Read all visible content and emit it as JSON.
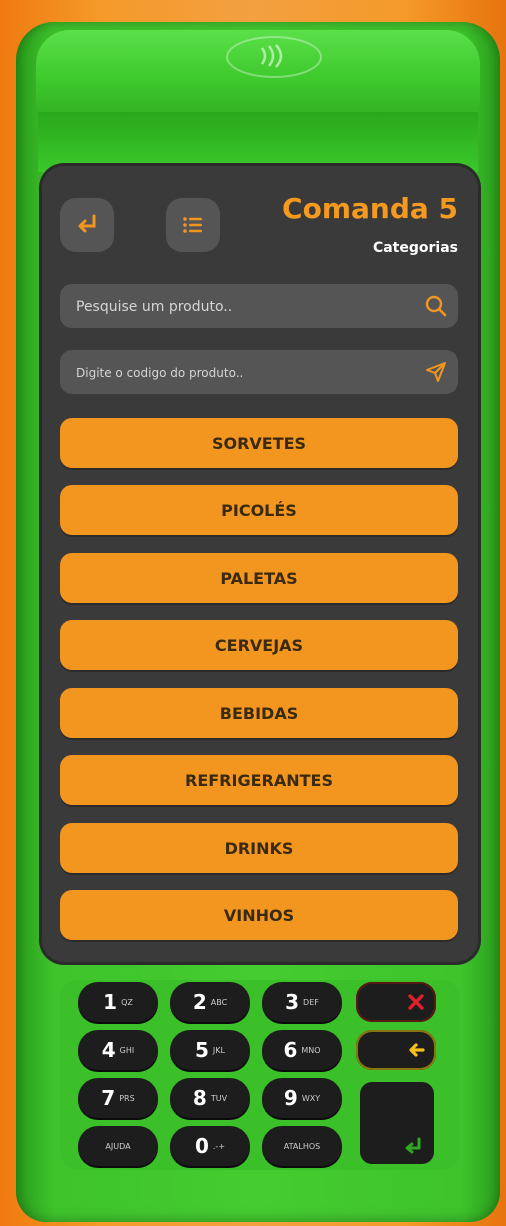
{
  "header": {
    "title": "Comanda 5",
    "subtitle": "Categorias"
  },
  "search": {
    "placeholder": "Pesquise um produto.."
  },
  "code": {
    "placeholder": "Digite o codigo do produto.."
  },
  "categories": [
    "SORVETES",
    "PICOLÉS",
    "PALETAS",
    "CERVEJAS",
    "BEBIDAS",
    "REFRIGERANTES",
    "DRINKS",
    "VINHOS"
  ],
  "keypad": {
    "k1": {
      "num": "1",
      "sub": "QZ"
    },
    "k2": {
      "num": "2",
      "sub": "ABC"
    },
    "k3": {
      "num": "3",
      "sub": "DEF"
    },
    "k4": {
      "num": "4",
      "sub": "GHI"
    },
    "k5": {
      "num": "5",
      "sub": "JKL"
    },
    "k6": {
      "num": "6",
      "sub": "MNO"
    },
    "k7": {
      "num": "7",
      "sub": "PRS"
    },
    "k8": {
      "num": "8",
      "sub": "TUV"
    },
    "k9": {
      "num": "9",
      "sub": "WXY"
    },
    "k0": {
      "num": "0",
      "sub": ".-+"
    },
    "help": "AJUDA",
    "shortcuts": "ATALHOS"
  },
  "colors": {
    "accent": "#f3961f",
    "screen": "#3a3a3a",
    "device": "#44cc30",
    "cancel": "#e0202a",
    "back": "#f5c01a",
    "confirm": "#2ea822"
  },
  "icons": [
    "return-icon",
    "list-icon",
    "search-icon",
    "send-icon",
    "nfc-icon",
    "cancel-x-icon",
    "backspace-arrow-icon",
    "enter-icon"
  ]
}
